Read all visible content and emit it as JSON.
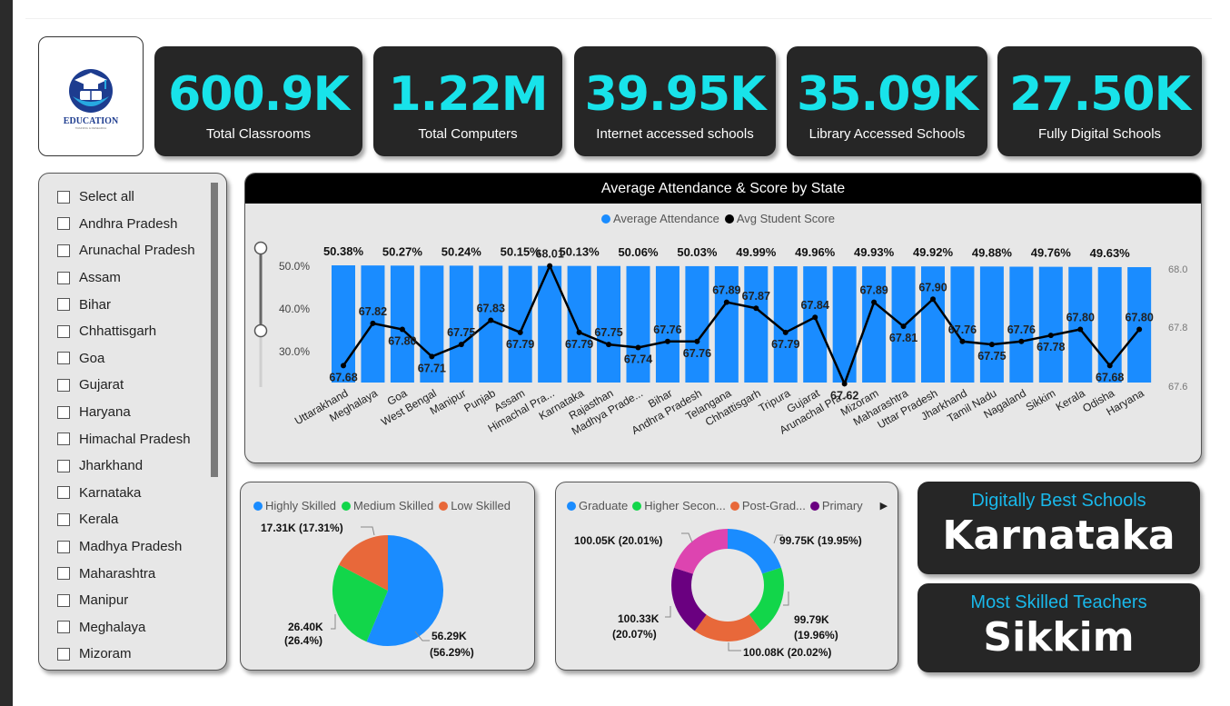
{
  "logo": {
    "text": "EDUCATION",
    "sub": "TRAINING & RESEARCH"
  },
  "kpis": [
    {
      "value": "600.9K",
      "label": "Total Classrooms"
    },
    {
      "value": "1.22M",
      "label": "Total Computers"
    },
    {
      "value": "39.95K",
      "label": "Internet accessed schools"
    },
    {
      "value": "35.09K",
      "label": "Library Accessed Schools"
    },
    {
      "value": "27.50K",
      "label": "Fully Digital Schools"
    }
  ],
  "slicer": {
    "items": [
      "Select all",
      "Andhra Pradesh",
      "Arunachal Pradesh",
      "Assam",
      "Bihar",
      "Chhattisgarh",
      "Goa",
      "Gujarat",
      "Haryana",
      "Himachal Pradesh",
      "Jharkhand",
      "Karnataka",
      "Kerala",
      "Madhya Pradesh",
      "Maharashtra",
      "Manipur",
      "Meghalaya",
      "Mizoram"
    ]
  },
  "combo": {
    "title": "Average Attendance & Score by State",
    "legend": [
      "Average Attendance",
      "Avg Student Score"
    ],
    "legend_colors": [
      "#1a8cff",
      "#000000"
    ],
    "bar_color": "#1a8cff",
    "left_ticks": [
      "50.0%",
      "40.0%",
      "30.0%"
    ],
    "right_ticks": [
      "68.0",
      "67.8",
      "67.6"
    ]
  },
  "chart_data": [
    {
      "type": "bar+line",
      "title": "Average Attendance & Score by State",
      "categories": [
        "Uttarakhand",
        "Meghalaya",
        "Goa",
        "West Bengal",
        "Manipur",
        "Punjab",
        "Assam",
        "Himachal Pra...",
        "Karnataka",
        "Rajasthan",
        "Madhya Prade...",
        "Bihar",
        "Andhra Pradesh",
        "Telangana",
        "Chhattisgarh",
        "Tripura",
        "Gujarat",
        "Arunachal Pra...",
        "Mizoram",
        "Maharashtra",
        "Uttar Pradesh",
        "Jharkhand",
        "Tamil Nadu",
        "Nagaland",
        "Sikkim",
        "Kerala",
        "Odisha",
        "Haryana"
      ],
      "series": [
        {
          "name": "Average Attendance",
          "axis": "left",
          "unit": "%",
          "values": [
            50.38,
            50.33,
            50.27,
            50.26,
            50.24,
            50.2,
            50.15,
            50.14,
            50.13,
            50.1,
            50.06,
            50.05,
            50.03,
            50.01,
            49.99,
            49.98,
            49.96,
            49.95,
            49.93,
            49.93,
            49.92,
            49.9,
            49.88,
            49.8,
            49.76,
            49.7,
            49.63,
            49.6
          ]
        },
        {
          "name": "Avg Student Score",
          "axis": "right",
          "values": [
            67.68,
            67.82,
            67.8,
            67.71,
            67.75,
            67.83,
            67.79,
            68.01,
            67.79,
            67.75,
            67.74,
            67.76,
            67.76,
            67.89,
            67.87,
            67.79,
            67.84,
            67.62,
            67.89,
            67.81,
            67.9,
            67.76,
            67.75,
            67.76,
            67.78,
            67.8,
            67.68,
            67.8
          ]
        }
      ],
      "shown_bar_labels": [
        "50.38%",
        "50.27%",
        "50.24%",
        "50.15%",
        "50.13%",
        "50.06%",
        "50.03%",
        "49.99%",
        "49.96%",
        "49.93%",
        "49.92%",
        "49.88%",
        "49.76%",
        "49.63%"
      ],
      "y_left_ticks": [
        "50.0%",
        "40.0%",
        "30.0%"
      ],
      "y_right_ticks": [
        "68.0",
        "67.8",
        "67.6"
      ],
      "legend_position": "top-center"
    },
    {
      "type": "pie",
      "legend": [
        "Highly Skilled",
        "Medium Skilled",
        "Low Skilled"
      ],
      "colors": [
        "#1a8cff",
        "#12d64a",
        "#e8683a"
      ],
      "values": [
        56.29,
        26.4,
        17.31
      ],
      "labels": [
        "56.29K (56.29%)",
        "26.40K (26.4%)",
        "17.31K (17.31%)"
      ]
    },
    {
      "type": "donut",
      "legend": [
        "Graduate",
        "Higher Secon...",
        "Post-Grad...",
        "Primary"
      ],
      "colors": [
        "#1a8cff",
        "#12d64a",
        "#e8683a",
        "#6a0080",
        "#dd44b0"
      ],
      "values": [
        99.75,
        99.79,
        100.08,
        100.33,
        100.05
      ],
      "labels": [
        "99.75K (19.95%)",
        "99.79K (19.96%)",
        "100.08K (20.02%)",
        "100.33K (20.07%)",
        "100.05K (20.01%)"
      ]
    }
  ],
  "pie": {
    "legend": [
      "Highly Skilled",
      "Medium Skilled",
      "Low Skilled"
    ],
    "label_big_1": "56.29K",
    "label_big_2": "(56.29%)",
    "label_med_1": "26.40K",
    "label_med_2": "(26.4%)",
    "label_low": "17.31K (17.31%)"
  },
  "donut": {
    "legend": [
      "Graduate",
      "Higher Secon...",
      "Post-Grad...",
      "Primary"
    ],
    "l1": "99.75K (19.95%)",
    "l2a": "99.79K",
    "l2b": "(19.96%)",
    "l3": "100.08K (20.02%)",
    "l4a": "100.33K",
    "l4b": "(20.07%)",
    "l5": "100.05K (20.01%)"
  },
  "cards": [
    {
      "title": "Digitally Best Schools",
      "value": "Karnataka"
    },
    {
      "title": "Most Skilled Teachers",
      "value": "Sikkim"
    }
  ]
}
